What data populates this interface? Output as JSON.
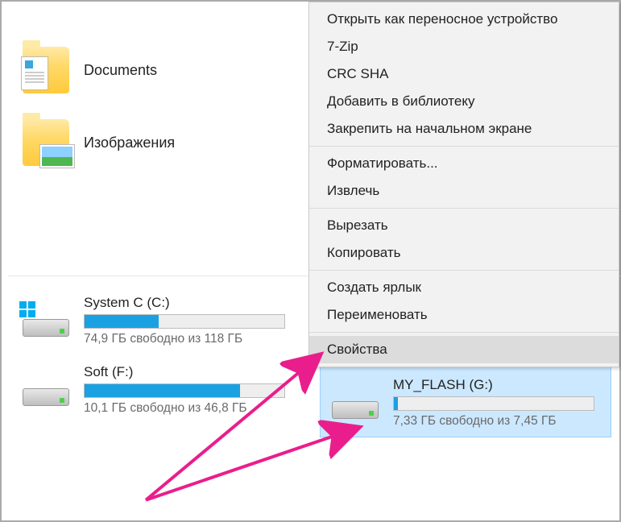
{
  "folders": [
    {
      "label": "Documents",
      "type": "docs"
    },
    {
      "label": "Изображения",
      "type": "pics"
    }
  ],
  "drives": [
    {
      "name": "System C (C:)",
      "free_text": "74,9 ГБ свободно из 118 ГБ",
      "fill_pct": 37,
      "os": true
    },
    {
      "name": "Soft (F:)",
      "free_text": "10,1 ГБ свободно из 46,8 ГБ",
      "fill_pct": 78,
      "os": false
    },
    {
      "name": "MY_FLASH (G:)",
      "free_text": "7,33 ГБ свободно из 7,45 ГБ",
      "fill_pct": 2,
      "os": false,
      "selected": true
    }
  ],
  "context_menu": {
    "groups": [
      [
        "Открыть как переносное устройство",
        "7-Zip",
        "CRC SHA",
        "Добавить в библиотеку",
        "Закрепить на начальном экране"
      ],
      [
        "Форматировать...",
        "Извлечь"
      ],
      [
        "Вырезать",
        "Копировать"
      ],
      [
        "Создать ярлык",
        "Переименовать"
      ],
      [
        "Свойства"
      ]
    ],
    "highlight": "Свойства"
  }
}
